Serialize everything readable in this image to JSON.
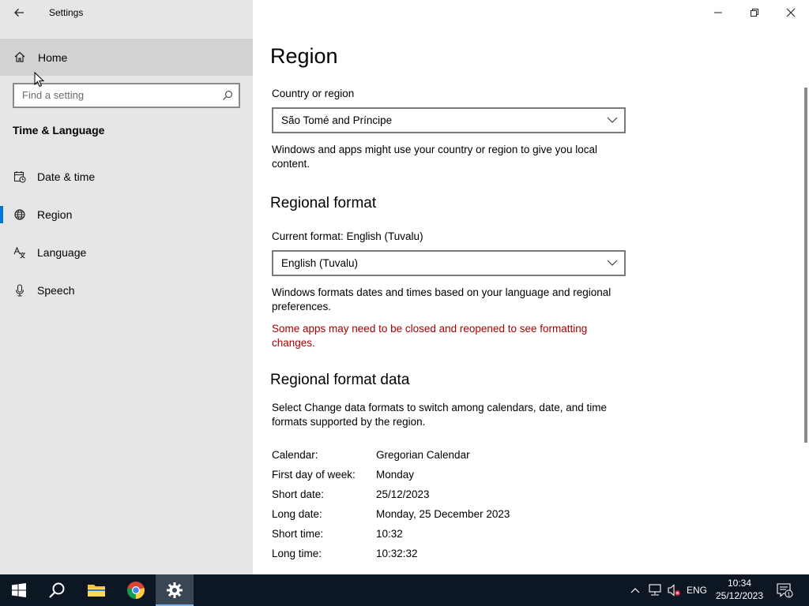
{
  "window": {
    "title": "Settings"
  },
  "sidebar": {
    "home_label": "Home",
    "search_placeholder": "Find a setting",
    "section_title": "Time & Language",
    "items": [
      {
        "label": "Date & time",
        "icon": "calendar-clock-icon",
        "selected": false
      },
      {
        "label": "Region",
        "icon": "globe-icon",
        "selected": true
      },
      {
        "label": "Language",
        "icon": "language-icon",
        "selected": false
      },
      {
        "label": "Speech",
        "icon": "microphone-icon",
        "selected": false
      }
    ]
  },
  "main": {
    "title": "Region",
    "country_label": "Country or region",
    "country_value": "São Tomé and Príncipe",
    "country_desc": "Windows and apps might use your country or region to give you local content.",
    "regional_format_heading": "Regional format",
    "current_format_label": "Current format: English (Tuvalu)",
    "format_value": "English (Tuvalu)",
    "format_desc": "Windows formats dates and times based on your language and regional preferences.",
    "format_warning": "Some apps may need to be closed and reopened to see formatting changes.",
    "format_data_heading": "Regional format data",
    "format_data_desc": "Select Change data formats to switch among calendars, date, and time formats supported by the region.",
    "format_data": [
      {
        "key": "Calendar:",
        "value": "Gregorian Calendar"
      },
      {
        "key": "First day of week:",
        "value": "Monday"
      },
      {
        "key": "Short date:",
        "value": "25/12/2023"
      },
      {
        "key": "Long date:",
        "value": "Monday, 25 December 2023"
      },
      {
        "key": "Short time:",
        "value": "10:32"
      },
      {
        "key": "Long time:",
        "value": "10:32:32"
      }
    ]
  },
  "taskbar": {
    "language": "ENG",
    "time": "10:34",
    "date": "25/12/2023",
    "notification_count": "1"
  },
  "colors": {
    "accent": "#0078d7",
    "warning": "#a80000",
    "sidebar_bg": "#e6e6e6",
    "taskbar_bg": "#0d1723"
  }
}
